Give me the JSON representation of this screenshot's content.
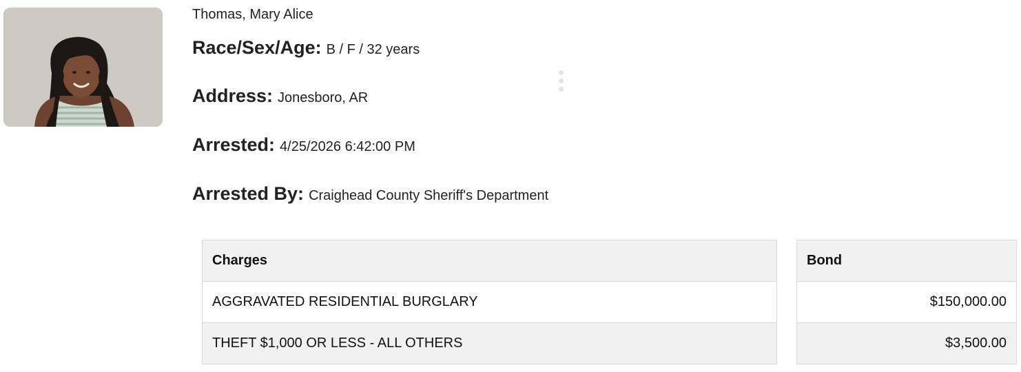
{
  "inmate": {
    "name": "Thomas, Mary Alice",
    "photo_icon": "mugshot-photo"
  },
  "details": {
    "race_sex_age_label": "Race/Sex/Age:",
    "race_sex_age_value": "B / F / 32 years",
    "address_label": "Address:",
    "address_value": "Jonesboro, AR",
    "arrested_label": "Arrested:",
    "arrested_value": "4/25/2026 6:42:00 PM",
    "arrested_by_label": "Arrested By:",
    "arrested_by_value": "Craighead County Sheriff's Department"
  },
  "menu": {
    "icon": "more-vertical-icon"
  },
  "charges_table": {
    "header": "Charges",
    "rows": [
      "AGGRAVATED RESIDENTIAL BURGLARY",
      "THEFT $1,000 OR LESS - ALL OTHERS"
    ]
  },
  "bond_table": {
    "header": "Bond",
    "rows": [
      "$150,000.00",
      "$3,500.00"
    ]
  },
  "colors": {
    "table_header_bg": "#f1f1f1",
    "table_border": "#d9d9d9",
    "text": "#222222"
  }
}
